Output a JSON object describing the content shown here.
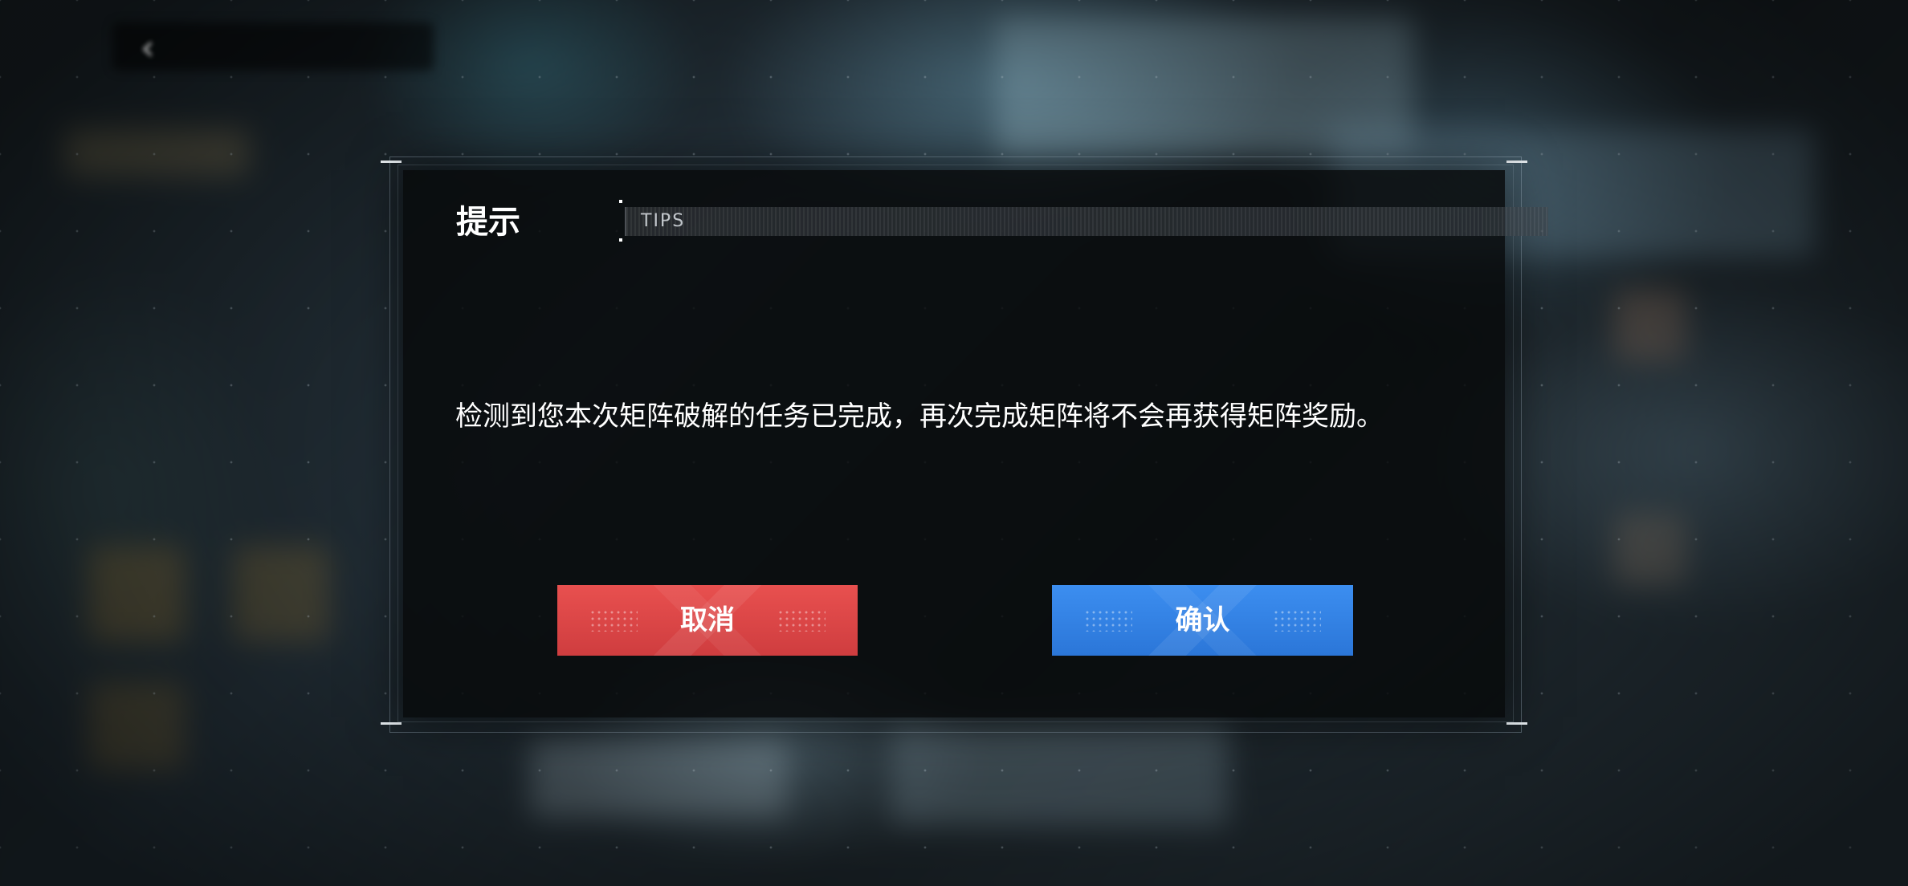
{
  "dialog": {
    "title": "提示",
    "subtitle": "TIPS",
    "message": "检测到您本次矩阵破解的任务已完成，再次完成矩阵将不会再获得矩阵奖励。",
    "cancel_label": "取消",
    "confirm_label": "确认"
  },
  "colors": {
    "cancel_button": "#d94445",
    "confirm_button": "#3482e4",
    "dialog_background": "#0a0c0e"
  },
  "icons": {
    "back": "chevron-left-icon"
  }
}
